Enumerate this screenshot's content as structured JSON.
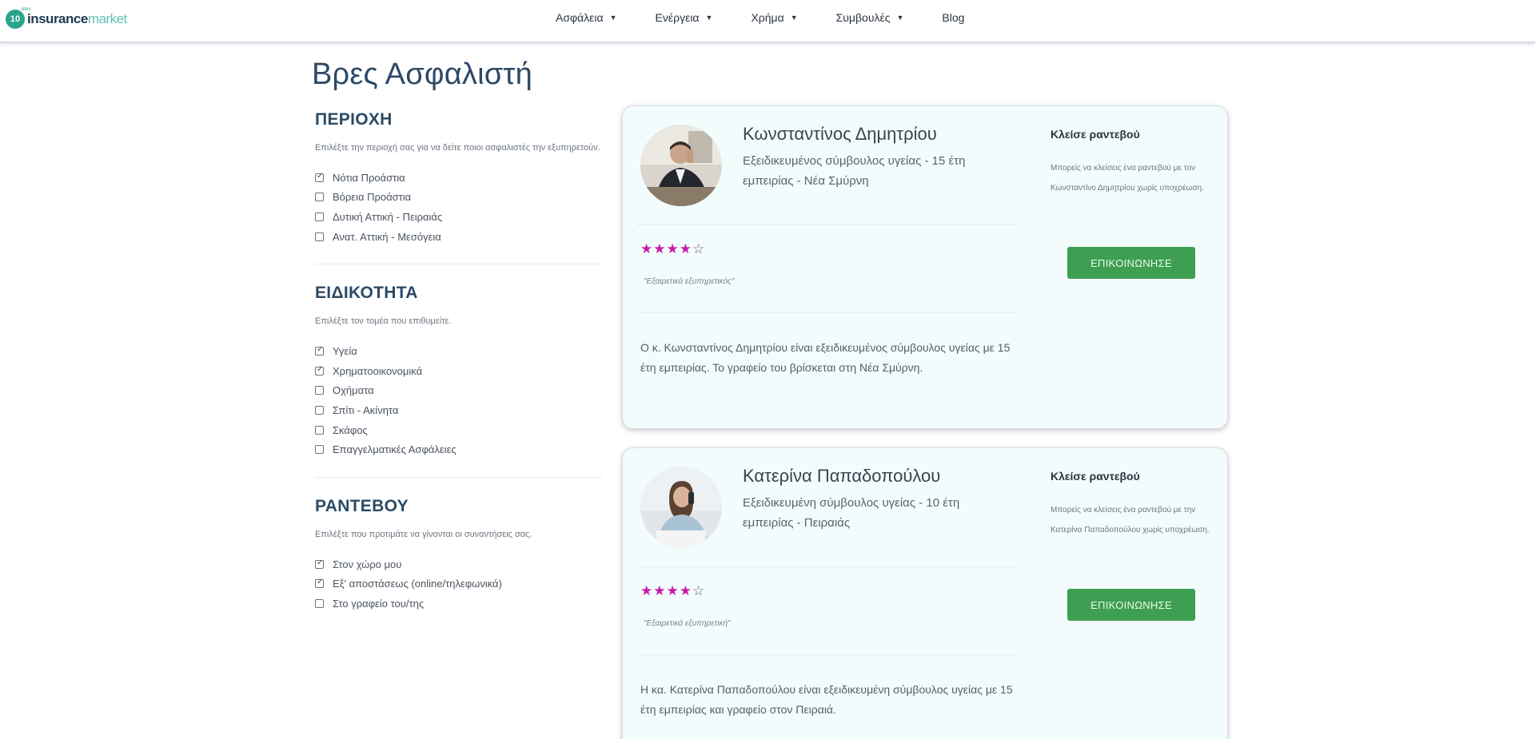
{
  "header": {
    "logo": {
      "badge": "10",
      "badge_sup": "sites",
      "brand_bold": "insurance",
      "brand_light": "market"
    },
    "nav": [
      {
        "label": "Ασφάλεια",
        "has_dropdown": true
      },
      {
        "label": "Ενέργεια",
        "has_dropdown": true
      },
      {
        "label": "Χρήμα",
        "has_dropdown": true
      },
      {
        "label": "Συμβουλές",
        "has_dropdown": true
      },
      {
        "label": "Blog",
        "has_dropdown": false
      }
    ]
  },
  "page_title": "Βρες Ασφαλιστή",
  "filters": [
    {
      "heading": "ΠΕΡΙΟΧΗ",
      "description": "Επιλέξτε την περιοχή σας για να δείτε ποιοι ασφαλιστές την εξυπηρετούν.",
      "options": [
        {
          "label": "Νότια Προάστια",
          "checked": true
        },
        {
          "label": "Βόρεια Προάστια",
          "checked": false
        },
        {
          "label": "Δυτική Αττική - Πειραιάς",
          "checked": false
        },
        {
          "label": "Ανατ. Αττική - Μεσόγεια",
          "checked": false
        }
      ]
    },
    {
      "heading": "ΕΙΔΙΚΟΤΗΤΑ",
      "description": "Επιλέξτε τον τομέα που επιθυμείτε.",
      "options": [
        {
          "label": "Υγεία",
          "checked": true
        },
        {
          "label": "Χρηματοοικονομικά",
          "checked": true
        },
        {
          "label": "Οχήματα",
          "checked": false
        },
        {
          "label": "Σπίτι - Ακίνητα",
          "checked": false
        },
        {
          "label": "Σκάφος",
          "checked": false
        },
        {
          "label": "Επαγγελματικές Ασφάλειες",
          "checked": false
        }
      ]
    },
    {
      "heading": "ΡΑΝΤΕΒΟΥ",
      "description": "Επιλέξτε που προτιμάτε να γίνονται οι συναντήσεις σας.",
      "options": [
        {
          "label": "Στον χώρο μου",
          "checked": true
        },
        {
          "label": "Εξ' αποστάσεως (online/τηλεφωνικά)",
          "checked": true
        },
        {
          "label": "Στο γραφείο του/της",
          "checked": false
        }
      ]
    }
  ],
  "advisors": [
    {
      "name": "Κωνσταντίνος Δημητρίου",
      "role": "Εξειδικευμένος σύμβουλος υγείας - 15 έτη εμπειρίας - Νέα Σμύρνη",
      "rating": 4,
      "rating_max": 5,
      "quote": "\"Εξαιρετικά εξυπηρετικός\"",
      "bio": "Ο κ. Κωνσταντίνος Δημητρίου είναι εξειδικευμένος σύμβουλος υγείας με 15 έτη εμπειρίας. Το γραφείο του βρίσκεται στη Νέα Σμύρνη.",
      "appointment_title": "Κλείσε ραντεβού",
      "appointment_desc": "Μπορείς να κλείσεις ένα ραντεβού με τον Κωνσταντίνο Δημητρίου χωρίς υποχρέωση.",
      "button_label": "ΕΠΙΚΟΙΝΩΝΗΣΕ"
    },
    {
      "name": "Κατερίνα Παπαδοπούλου",
      "role": "Εξειδικευμένη σύμβουλος υγείας - 10 έτη εμπειρίας - Πειραιάς",
      "rating": 4,
      "rating_max": 5,
      "quote": "\"Εξαιρετικά εξυπηρετική\"",
      "bio": "Η κα. Κατερίνα Παπαδοπούλου είναι εξειδικευμένη σύμβουλος υγείας με 15 έτη εμπειρίας και γραφείο στον Πειραιά.",
      "appointment_title": "Κλείσε ραντεβού",
      "appointment_desc": "Μπορείς να κλείσεις ένα ραντεβού με την Κατερίνα Παπαδοπούλου χωρίς υποχρέωση.",
      "button_label": "ΕΠΙΚΟΙΝΩΝΗΣΕ"
    }
  ],
  "colors": {
    "accent_green": "#3e9e52",
    "star": "#c81aa8",
    "heading": "#2c4a66",
    "card_bg": "#f2fcfc",
    "logo_teal": "#2aa58c"
  }
}
